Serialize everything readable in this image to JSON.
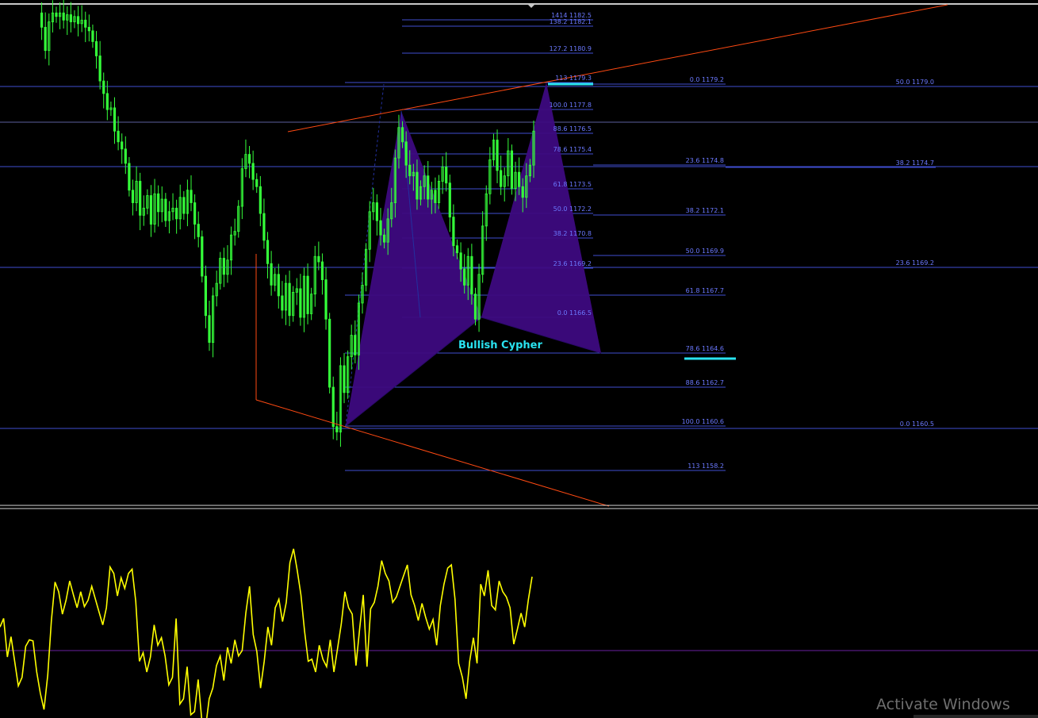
{
  "colors": {
    "background": "#000000",
    "fib_line": "#3f4ed0",
    "fib_text": "#6b79ff",
    "trendline": "#ff4a12",
    "candles": "#35ff3a",
    "pattern_fill": "#3d0a7f",
    "pattern_label": "#29e3f0",
    "highlight": "#29e3f0",
    "oscillator": "#ffff00",
    "osc_zero": "#6a1fa0",
    "separator": "#d8d8d8",
    "watermark": "#6f6f6f"
  },
  "chart_data": [
    {
      "type": "line",
      "title": "",
      "xlabel": "",
      "ylabel": "",
      "ylim": [
        1156.5,
        1184.5
      ],
      "grid": false,
      "series": [
        {
          "kind": "price",
          "values": [
            1184.0,
            1183.2,
            1181.9,
            1183.5,
            1184.0,
            1183.8,
            1184.0,
            1183.6,
            1183.9,
            1183.5,
            1183.8,
            1183.4,
            1183.6,
            1183.2,
            1183.0,
            1182.4,
            1181.6,
            1180.2,
            1179.5,
            1178.6,
            1178.7,
            1177.4,
            1176.8,
            1176.4,
            1175.6,
            1174.1,
            1173.4,
            1174.6,
            1172.7,
            1173.1,
            1173.8,
            1172.2,
            1173.9,
            1172.9,
            1173.6,
            1172.4,
            1172.9,
            1173.1,
            1172.5,
            1173.7,
            1172.8,
            1174.1,
            1173.4,
            1172.2,
            1171.5,
            1169.3,
            1167.1,
            1165.6,
            1168.2,
            1168.9,
            1170.3,
            1169.4,
            1170.2,
            1171.6,
            1171.8,
            1173.2,
            1175.3,
            1176.1,
            1175.6,
            1174.7,
            1174.3,
            1172.8,
            1171.3,
            1170.0,
            1168.8,
            1169.4,
            1168.2,
            1167.4,
            1168.9,
            1167.1,
            1168.4,
            1168.6,
            1167.0,
            1169.3,
            1167.2,
            1168.3,
            1170.4,
            1170.1,
            1169.1,
            1166.9,
            1163.1,
            1160.9,
            1160.6,
            1164.3,
            1162.8,
            1164.8,
            1166.0,
            1164.9,
            1167.8,
            1168.8,
            1170.8,
            1172.9,
            1173.4,
            1172.4,
            1171.6,
            1171.2,
            1172.5,
            1173.4,
            1175.9,
            1177.6,
            1176.8,
            1175.5,
            1174.9,
            1175.1,
            1173.6,
            1174.3,
            1174.9,
            1173.6,
            1174.1,
            1173.4,
            1174.6,
            1175.4,
            1174.5,
            1172.6,
            1171.0,
            1170.6,
            1169.7,
            1168.8,
            1170.4,
            1168.3,
            1166.9,
            1169.4,
            1172.1,
            1173.9,
            1175.8,
            1176.9,
            1175.2,
            1174.3,
            1174.9,
            1176.3,
            1174.2,
            1175.1,
            1174.3,
            1173.7,
            1174.9,
            1175.5,
            1177.4
          ]
        },
        {
          "kind": "oscillator",
          "values": [
            22,
            30,
            -6,
            13,
            -10,
            -33,
            -25,
            4,
            10,
            9,
            -20,
            -40,
            -55,
            -23,
            28,
            64,
            55,
            34,
            47,
            65,
            52,
            40,
            55,
            41,
            47,
            60,
            48,
            36,
            24,
            40,
            78,
            72,
            51,
            68,
            58,
            72,
            76,
            46,
            -10,
            -2,
            -20,
            -6,
            24,
            5,
            12,
            -5,
            -32,
            -25,
            30,
            -50,
            -45,
            -15,
            -60,
            -57,
            -27,
            -65,
            -73,
            -45,
            -35,
            -14,
            -5,
            -28,
            3,
            -12,
            10,
            -5,
            0,
            35,
            60,
            15,
            -1,
            -35,
            -10,
            22,
            5,
            40,
            48,
            27,
            45,
            82,
            95,
            75,
            52,
            18,
            -10,
            -8,
            -20,
            5,
            -8,
            -15,
            10,
            -20,
            2,
            25,
            55,
            40,
            34,
            -14,
            20,
            52,
            -15,
            39,
            45,
            60,
            84,
            72,
            65,
            45,
            50,
            60,
            70,
            80,
            52,
            42,
            28,
            44,
            31,
            20,
            29,
            5,
            42,
            62,
            77,
            80,
            48,
            -12,
            -25,
            -45,
            -10,
            12,
            -12,
            62,
            51,
            75,
            42,
            38,
            65,
            55,
            50,
            40,
            6,
            20,
            35,
            22,
            48,
            69
          ]
        }
      ],
      "fib_levels": [
        {
          "label": "1414 1182.5"
        },
        {
          "label": "138.2 1182.1"
        },
        {
          "label": "127.2 1180.9"
        },
        {
          "label": "113 1179.3"
        },
        {
          "label": "100.0 1177.8"
        },
        {
          "label": "88.6 1176.5"
        },
        {
          "label": "78.6 1175.4"
        },
        {
          "label": "61.8 1173.5"
        },
        {
          "label": "50.0 1172.2"
        },
        {
          "label": "38.2 1170.8"
        },
        {
          "label": "23.6 1169.2"
        },
        {
          "label": "0.0 1166.5"
        },
        {
          "label": "0.0 1179.2"
        },
        {
          "label": "23.6 1174.8"
        },
        {
          "label": "38.2 1172.1"
        },
        {
          "label": "50.0 1169.9"
        },
        {
          "label": "61.8 1167.7"
        },
        {
          "label": "78.6 1164.6"
        },
        {
          "label": "88.6 1162.7"
        },
        {
          "label": "100.0 1160.6"
        },
        {
          "label": "113 1158.2"
        },
        {
          "label": "50.0 1179.0"
        },
        {
          "label": "38.2 1174.7"
        },
        {
          "label": "23.6 1169.2"
        },
        {
          "label": "0.0 1160.5"
        }
      ],
      "annotations": [
        "Bullish Cypher"
      ]
    }
  ],
  "watermark": {
    "line1": "Activate Windows"
  }
}
